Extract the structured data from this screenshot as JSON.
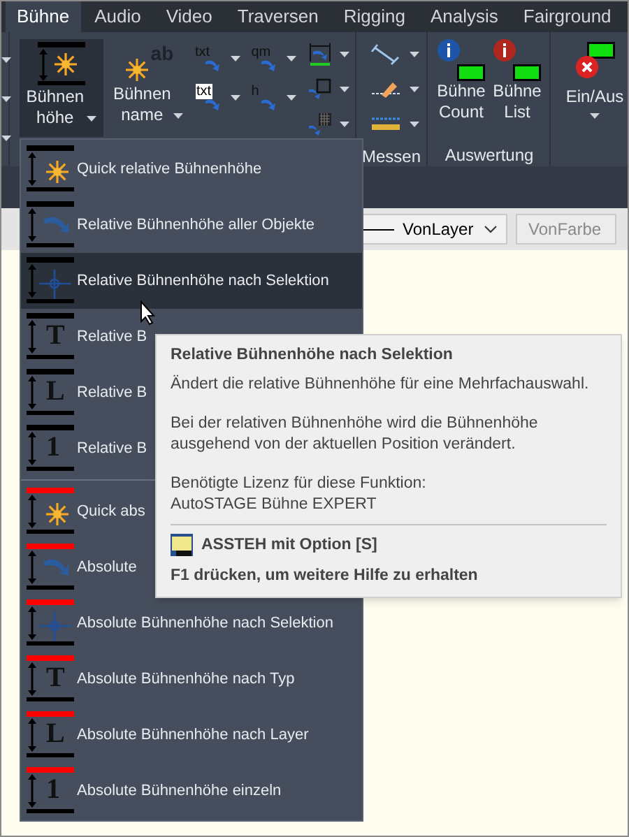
{
  "tabs": [
    {
      "label": "Bühne",
      "selected": true
    },
    {
      "label": "Audio",
      "selected": false
    },
    {
      "label": "Video",
      "selected": false
    },
    {
      "label": "Traversen",
      "selected": false
    },
    {
      "label": "Rigging",
      "selected": false
    },
    {
      "label": "Analysis",
      "selected": false
    },
    {
      "label": "Fairground",
      "selected": false
    }
  ],
  "ribbon": {
    "height_button": {
      "lines": [
        "Bühnen",
        "höhe"
      ],
      "selected": true
    },
    "name_button": {
      "lines": [
        "Bühnen",
        "name"
      ],
      "icon_text": "ab"
    },
    "small_tools": [
      {
        "text": "txt",
        "boxed": false
      },
      {
        "text": "qm",
        "boxed": false
      },
      {
        "text": "txt",
        "boxed": true
      },
      {
        "text": "h",
        "boxed": false
      }
    ],
    "group_labels": [
      "Messen",
      "Auswertung"
    ],
    "count_buttons": [
      {
        "lines": [
          "Bühne",
          "Count"
        ],
        "kind": "info"
      },
      {
        "lines": [
          "Bühne",
          "List"
        ],
        "kind": "warning"
      }
    ],
    "toggle_button": {
      "label": "Ein/Aus"
    }
  },
  "property_bar": {
    "linetype": "VonLayer",
    "color_field": "VonFarbe"
  },
  "menu": {
    "items": [
      {
        "label": "Quick relative Bühnenhöhe",
        "kind": "relative",
        "selected": false
      },
      {
        "label": "Relative Bühnenhöhe aller Objekte",
        "kind": "relative",
        "selected": false
      },
      {
        "label": "Relative Bühnenhöhe nach Selektion",
        "kind": "relative",
        "selected": true
      },
      {
        "label": "Relative B",
        "kind": "relative",
        "glyph": "T",
        "selected": false
      },
      {
        "label": "Relative B",
        "kind": "relative",
        "glyph": "L",
        "selected": false
      },
      {
        "label": "Relative B",
        "kind": "relative",
        "glyph": "1",
        "selected": false
      },
      {
        "label": "Quick abs",
        "kind": "absolute",
        "selected": false
      },
      {
        "label": "Absolute",
        "kind": "absolute",
        "selected": false
      },
      {
        "label": "Absolute Bühnenhöhe nach Selektion",
        "kind": "absolute",
        "selected": false
      },
      {
        "label": "Absolute Bühnenhöhe nach Typ",
        "kind": "absolute",
        "glyph": "T",
        "selected": false
      },
      {
        "label": "Absolute Bühnenhöhe nach Layer",
        "kind": "absolute",
        "glyph": "L",
        "selected": false
      },
      {
        "label": "Absolute Bühnenhöhe einzeln",
        "kind": "absolute",
        "glyph": "1",
        "selected": false
      }
    ]
  },
  "tooltip": {
    "title": "Relative Bühnenhöhe nach Selektion",
    "paragraphs": [
      "Ändert die relative Bühnenhöhe für eine Mehrfachauswahl.",
      "Bei der relativen Bühnenhöhe wird die Bühnenhöhe ausgehend von der aktuellen Position verändert."
    ],
    "license": [
      "Benötigte Lizenz für diese Funktion:",
      "AutoSTAGE Bühne EXPERT"
    ],
    "command": "ASSTEH mit Option [S]",
    "help": "F1 drücken, um weitere Hilfe zu erhalten"
  }
}
